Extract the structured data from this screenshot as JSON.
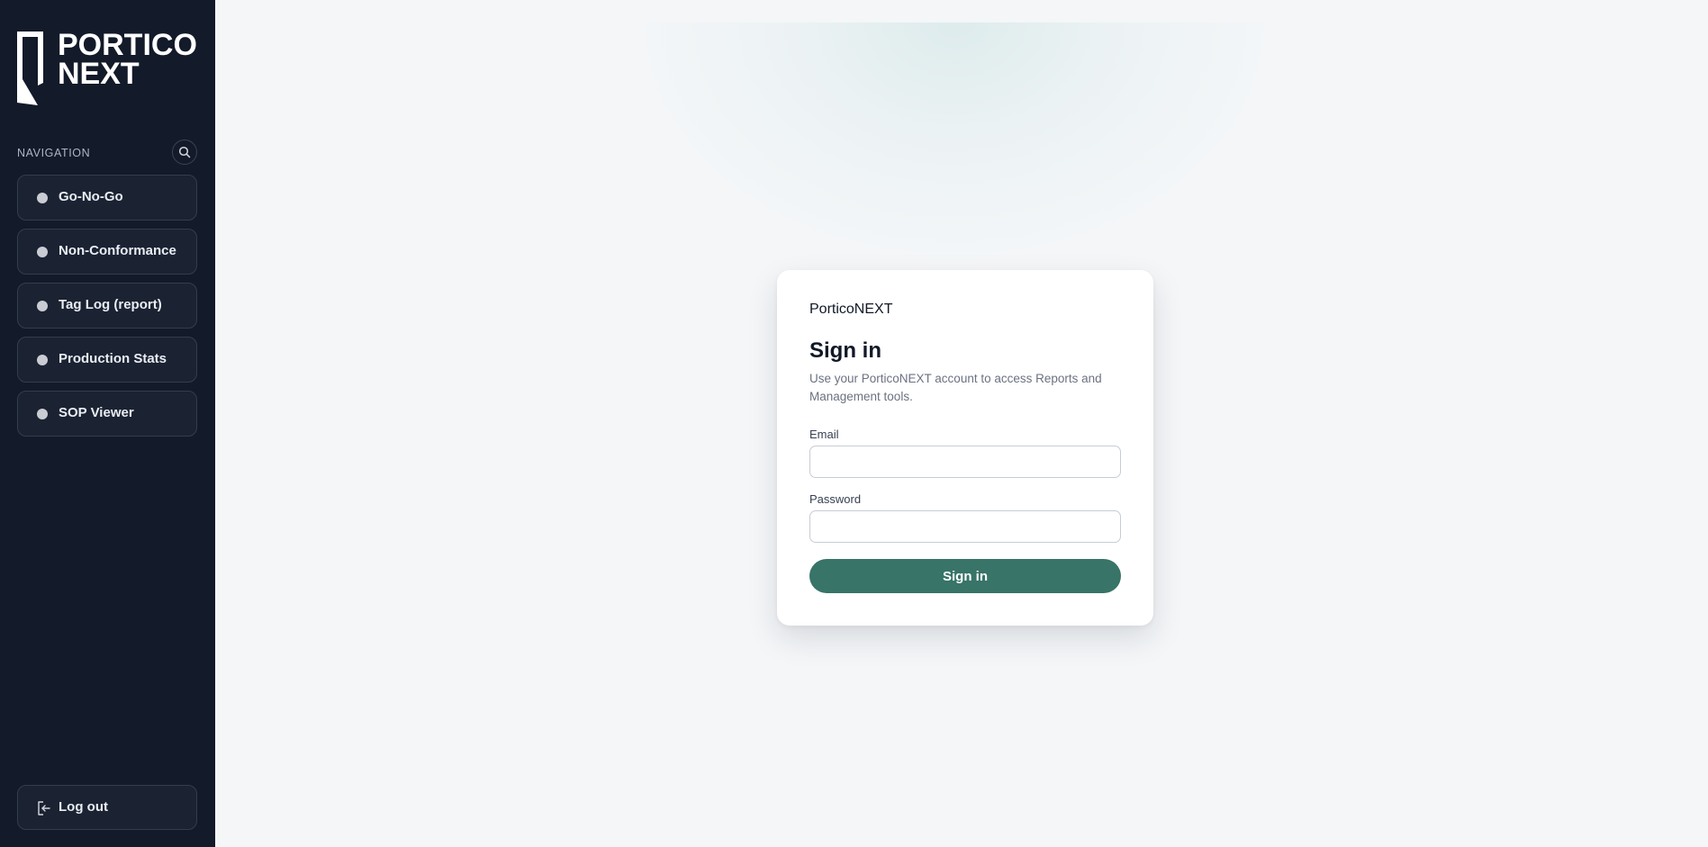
{
  "brand": {
    "logo_text_line1": "PORTICO",
    "logo_text_line2": "NEXT"
  },
  "sidebar": {
    "nav_title": "NAVIGATION",
    "search_icon": "search-icon",
    "items": [
      {
        "label": "Go-No-Go"
      },
      {
        "label": "Non-Conformance"
      },
      {
        "label": "Tag Log (report)"
      },
      {
        "label": "Production Stats"
      },
      {
        "label": "SOP Viewer"
      }
    ],
    "logout": {
      "label": "Log out",
      "icon": "logout-icon"
    }
  },
  "login": {
    "brand_name": "PorticoNEXT",
    "title": "Sign in",
    "subtitle": "Use your PorticoNEXT account to access Reports and Management tools.",
    "email_label": "Email",
    "email_value": "",
    "password_label": "Password",
    "password_value": "",
    "submit_label": "Sign in"
  },
  "colors": {
    "sidebar_bg": "#131a29",
    "page_bg": "#f4f6f8",
    "accent": "#387468"
  }
}
